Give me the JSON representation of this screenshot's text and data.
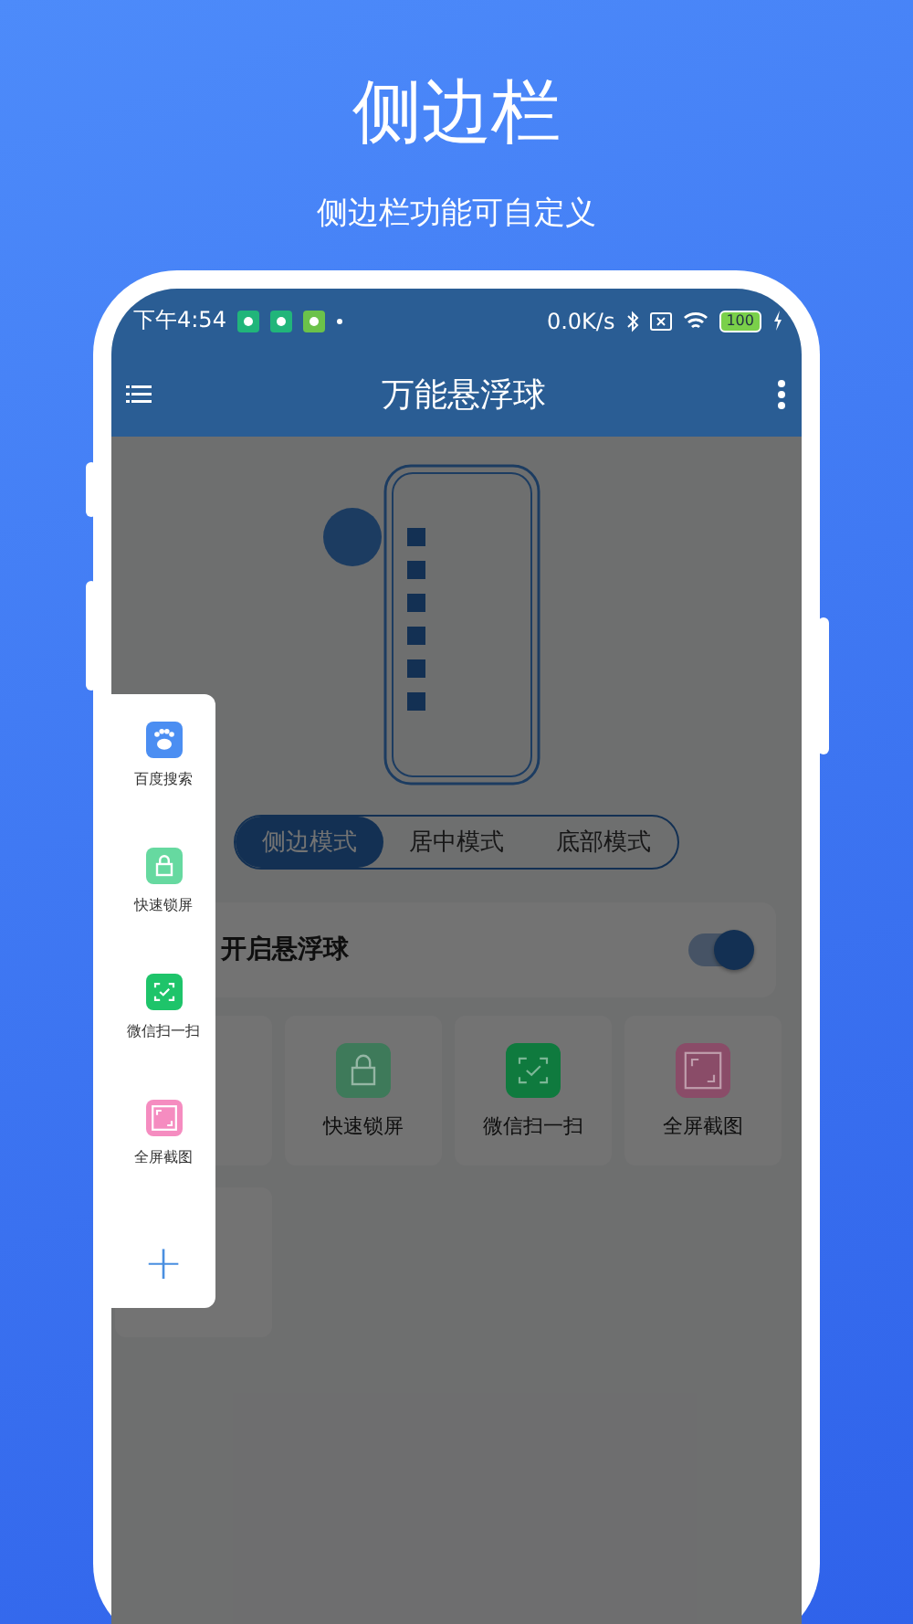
{
  "header": {
    "title": "侧边栏",
    "subtitle": "侧边栏功能可自定义"
  },
  "status_bar": {
    "time": "下午4:54",
    "network_speed": "0.0K/s",
    "battery": "100"
  },
  "app_bar": {
    "title": "万能悬浮球"
  },
  "modes": [
    {
      "label": "侧边模式",
      "selected": true
    },
    {
      "label": "居中模式",
      "selected": false
    },
    {
      "label": "底部模式",
      "selected": false
    }
  ],
  "float_ball_toggle": {
    "label": "开启悬浮球",
    "on": true
  },
  "shortcuts": [
    {
      "kind": "lock",
      "label": "快速锁屏",
      "color": "#3e7a5a"
    },
    {
      "kind": "scan",
      "label": "微信扫一扫",
      "color": "#0f7a3e"
    },
    {
      "kind": "screenshot",
      "label": "全屏截图",
      "color": "#8a4c68"
    }
  ],
  "sidebar": {
    "items": [
      {
        "kind": "paw",
        "label": "百度搜索",
        "color": "#4b8ef2"
      },
      {
        "kind": "lock",
        "label": "快速锁屏",
        "color": "#66d9a0"
      },
      {
        "kind": "scan",
        "label": "微信扫一扫",
        "color": "#1ec46a"
      },
      {
        "kind": "screenshot",
        "label": "全屏截图",
        "color": "#f58cc0"
      }
    ],
    "add_button": "+"
  }
}
